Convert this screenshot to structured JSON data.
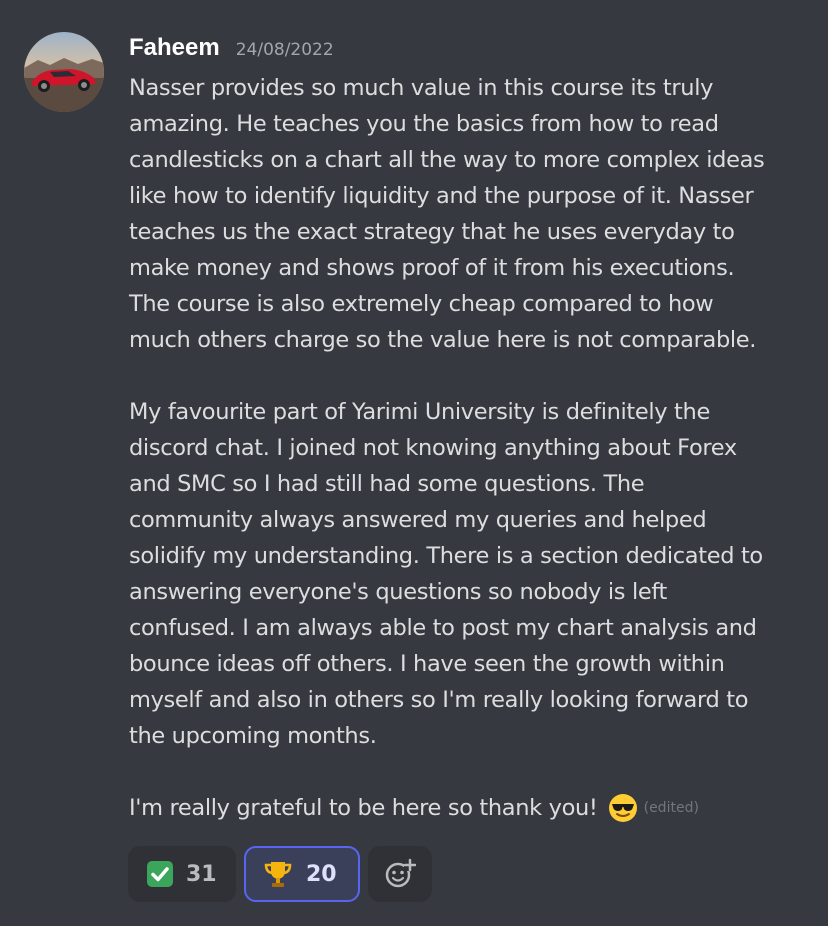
{
  "message": {
    "author": "Faheem",
    "timestamp": "24/08/2022",
    "avatar_icon": "red-sports-car-avatar",
    "paragraphs": [
      "Nasser provides so much value in this course its truly\namazing. He teaches you the basics from how to read\ncandlesticks on a chart all the way to more complex ideas\nlike how to identify liquidity and the purpose of it. Nasser\nteaches us the exact strategy that he uses everyday to\nmake money and shows proof of it from his executions.\nThe course is also extremely cheap compared to how\nmuch others charge so the value here is not comparable.",
      "My favourite part of Yarimi University is definitely the\ndiscord chat. I joined not knowing anything about Forex\nand SMC so I had still had some questions. The\ncommunity always answered my queries and helped\nsolidify my understanding. There is a section dedicated to\nanswering everyone's questions so nobody is left\nconfused. I am always able to post my chart analysis and\nbounce ideas off others. I have seen the growth within\nmyself and also in others so I'm really looking forward to\nthe upcoming months."
    ],
    "closing": "I'm really grateful to be here so thank you!",
    "closing_emoji": "sunglasses-emoji",
    "edited_label": "(edited)"
  },
  "reactions": [
    {
      "icon": "check-mark-emoji",
      "count": "31",
      "active": false
    },
    {
      "icon": "trophy-emoji",
      "count": "20",
      "active": true
    }
  ],
  "add_reaction_icon": "add-reaction-icon",
  "colors": {
    "background": "#36393f",
    "reaction_bg": "#2f3136",
    "reaction_active_border": "#5865f2",
    "check_green": "#3ba55c"
  }
}
